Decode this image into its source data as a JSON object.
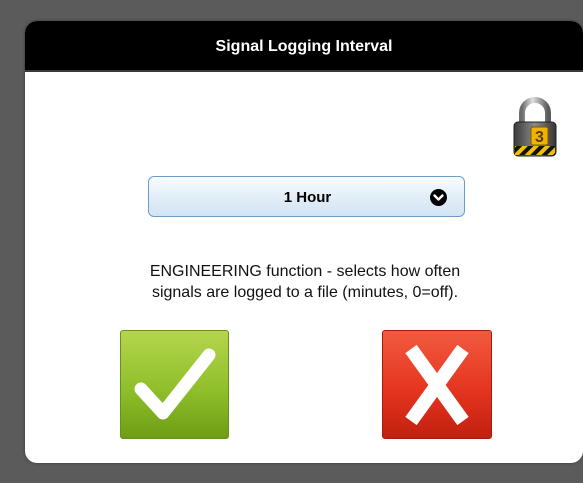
{
  "dialog": {
    "title": "Signal Logging Interval",
    "access_level": "3",
    "interval_select": {
      "selected_value": "1 Hour"
    },
    "description_line1": "ENGINEERING function - selects how often",
    "description_line2": "signals are logged to a file (minutes, 0=off).",
    "confirm_icon": "checkmark-icon",
    "cancel_icon": "x-icon",
    "lock_icon": "padlock-icon"
  },
  "colors": {
    "title_bar": "#000000",
    "confirm": "#8fbf2a",
    "cancel": "#e4351f",
    "dropdown": "#e3eef8"
  }
}
